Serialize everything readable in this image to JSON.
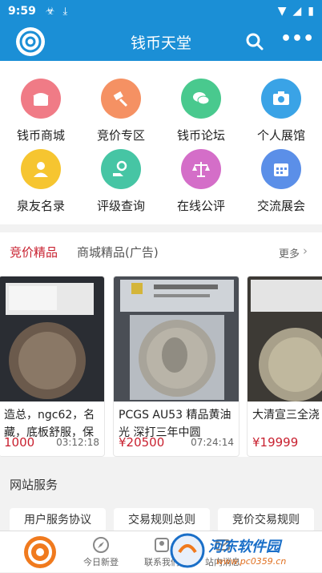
{
  "status": {
    "time": "9:59"
  },
  "header": {
    "title": "钱币天堂"
  },
  "grid": [
    {
      "label": "钱币商城",
      "icon": "shop-icon",
      "color": "#f07b86"
    },
    {
      "label": "竞价专区",
      "icon": "auction-hammer-icon",
      "color": "#f59163"
    },
    {
      "label": "钱币论坛",
      "icon": "chat-bubbles-icon",
      "color": "#49c98e"
    },
    {
      "label": "个人展馆",
      "icon": "camera-icon",
      "color": "#3aa3e6"
    },
    {
      "label": "泉友名录",
      "icon": "user-icon",
      "color": "#f6c530"
    },
    {
      "label": "评级查询",
      "icon": "search-hand-icon",
      "color": "#46c5a4"
    },
    {
      "label": "在线公评",
      "icon": "balance-scale-icon",
      "color": "#d46ec8"
    },
    {
      "label": "交流展会",
      "icon": "calendar-icon",
      "color": "#5b8fe8"
    }
  ],
  "tabs": {
    "active": "竞价精品",
    "inactive": "商城精品(广告)",
    "more": "更多"
  },
  "cards": [
    {
      "title": "造总，ngc62，名藏，底板舒服，保",
      "price": "1000",
      "time": "03:12:18"
    },
    {
      "title": "PCGS AU53 精品黄油光 深打三年中圆",
      "price": "¥20500",
      "time": "07:24:14"
    },
    {
      "title": "大清宣三全浇",
      "price": "¥19999",
      "time": ""
    }
  ],
  "services": {
    "title": "网站服务",
    "items": [
      "用户服务协议",
      "交易规则总则",
      "竞价交易规则"
    ]
  },
  "bottom_nav": [
    {
      "label": "",
      "icon": "home-logo-icon"
    },
    {
      "label": "今日新登",
      "icon": "compass-icon"
    },
    {
      "label": "联系我们",
      "icon": "contact-icon"
    },
    {
      "label": "站内消息",
      "icon": "message-icon"
    }
  ],
  "watermark": {
    "text": "河东软件园",
    "url": "www.pc0359.cn"
  }
}
